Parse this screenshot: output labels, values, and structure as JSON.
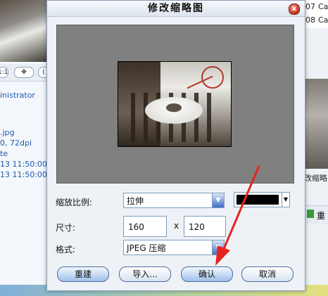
{
  "background": {
    "left_toolbar_buttons": [
      "1:1",
      "✥",
      "("
    ],
    "left_info_lines": [
      "inistrator",
      "",
      ".jpg",
      "0, 72dpi",
      "te",
      "13 11:50:00",
      "13 11:50:00"
    ],
    "right_grid": [
      "07",
      "Ca",
      "08",
      "Ca"
    ],
    "right_caption": "改缩略",
    "right_button": "重"
  },
  "dialog": {
    "title": "修改缩略图",
    "close_symbol": "x",
    "scale_label": "缩放比例:",
    "scale_value": "拉伸",
    "size_label": "尺寸:",
    "width": "160",
    "size_separator": "x",
    "height": "120",
    "format_label": "格式:",
    "format_value": "JPEG 压缩",
    "buttons": {
      "rebuild": "重建",
      "import": "导入...",
      "ok": "确认",
      "cancel": "取消"
    }
  },
  "colors": {
    "preview_bg": "#808080",
    "selected_fill_color": "#000000",
    "annotation_arrow": "#e8231d"
  }
}
